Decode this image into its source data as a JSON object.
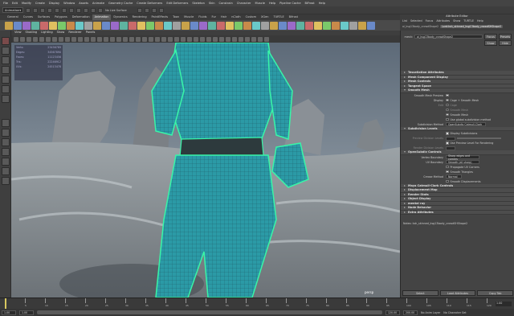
{
  "menubar": [
    "File",
    "Edit",
    "Modify",
    "Create",
    "Display",
    "Window",
    "Assets",
    "Animate",
    "Geometry Cache",
    "Create Deformers",
    "Edit Deformers",
    "Skeleton",
    "Skin",
    "Constrain",
    "Character",
    "Muscle",
    "Help",
    "Pipeline Cache",
    "BiFrost",
    "Help"
  ],
  "status": {
    "mode": "Animation",
    "live_surface": "No Live Surface"
  },
  "shelf_tabs": [
    "General",
    "Curves",
    "Surfaces",
    "Polygons",
    "Deformation",
    "Animation",
    "Dynamics",
    "Rendering",
    "PaintEffects",
    "Toon",
    "Muscle",
    "Fluids",
    "Fur",
    "Hair",
    "nCloth",
    "Custom",
    "XGen",
    "TURTLE",
    "Bifrost"
  ],
  "shelf_active": "Animation",
  "viewport_menu": [
    "View",
    "Shading",
    "Lighting",
    "Show",
    "Renderer",
    "Panels"
  ],
  "hud": [
    [
      "Verts:",
      "23456789"
    ],
    [
      "Edges:",
      "34567890"
    ],
    [
      "Faces:",
      "11123456"
    ],
    [
      "Tris:",
      "22246912"
    ],
    [
      "UVs:",
      "24513478"
    ]
  ],
  "camera_label": "persp",
  "attr_editor": {
    "title": "Attribute Editor",
    "menu": [
      "List",
      "Selected",
      "Focus",
      "Attributes",
      "Show",
      "TURTLE",
      "Help"
    ],
    "tab": "ai_ksg13body_crowdShape2",
    "tab2": "Lord:ksh_skinned_ksg13body_crowdSHShape2",
    "mesh_label": "mesh:",
    "mesh_value": "ai_ksg13body_crowdShape2",
    "focus_btn": "Focus",
    "presets_btn": "Presets",
    "show_btn": "Show",
    "hide_btn": "Hide",
    "sections": [
      {
        "label": "Tessellation Attributes",
        "open": false
      },
      {
        "label": "Mesh Component Display",
        "open": false
      },
      {
        "label": "Mesh Controls",
        "open": false
      },
      {
        "label": "Tangent Space",
        "open": false
      },
      {
        "label": "Smooth Mesh",
        "open": true
      }
    ],
    "smooth": {
      "preview_label": "Smooth Mesh Preview",
      "display_label": "Display",
      "display_opts": [
        "Cage + Smooth Mesh",
        "Cage",
        "Smooth Mesh"
      ],
      "edge_label": "Edit",
      "smooth_mesh": "Smooth Mesh",
      "use_global": "Use global subdivision method",
      "subdiv_method_label": "Subdivision Method",
      "subdiv_method": "OpenSubdiv Catmull-Clark"
    },
    "subdiv_levels": "Subdivision Levels",
    "display_subdivisions": "Display Subdivisions",
    "preview_division_label": "Preview Division Levels",
    "use_preview_level": "Use Preview Level For Rendering",
    "render_division_label": "Render Division Levels",
    "opensubdiv_controls": "OpenSubdiv Controls",
    "vertex_boundary_label": "Vertex Boundary",
    "vertex_boundary": "Sharp edges and corners",
    "uv_boundary_label": "UV Boundary",
    "uv_boundary": "Smooth (all sharp)",
    "propagate_uv": "Propagate UV Corners",
    "smooth_triangles": "Smooth Triangles",
    "crease_method_label": "Crease Method",
    "crease_method": "Normal",
    "smooth_displacements": "Smooth Displacements",
    "more_sections": [
      "Maya Catmull-Clark Controls",
      "Displacement Map",
      "Render Stats",
      "Object Display",
      "mental ray",
      "Node Behavior",
      "Extra Attributes"
    ],
    "notes": "Notes: ksh_skinned_ksg13body_crowdSHShape2",
    "buttons": [
      "Select",
      "Load Attributes",
      "Copy Tab"
    ]
  },
  "timeline": {
    "start": "1",
    "end": "120",
    "ticks": [
      "1",
      "5",
      "10",
      "15",
      "20",
      "25",
      "30",
      "35",
      "40",
      "45",
      "50",
      "55",
      "60",
      "65",
      "70",
      "75",
      "80",
      "85",
      "90",
      "95",
      "100",
      "105",
      "110",
      "115",
      "120"
    ],
    "current": "1.00"
  },
  "range": {
    "start": "1.00",
    "inner_start": "1.00",
    "inner_end": "120.00",
    "end": "200.00",
    "anim_layer": "No Anim Layer",
    "char_set": "No Character Set"
  },
  "colors": {
    "wire": "#39f5a8",
    "mesh": "#2aa9b6",
    "accent": "#5a5a5a"
  }
}
